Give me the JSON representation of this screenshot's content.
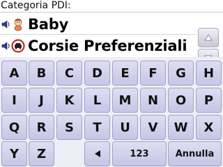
{
  "header": {
    "title": "Categoria PDI:"
  },
  "results": [
    {
      "label": "Baby",
      "speaker_icon": "speaker-icon",
      "category_icon": "baby-icon"
    },
    {
      "label": "Corsie Preferenziali",
      "speaker_icon": "speaker-icon",
      "category_icon": "car-pool-lane-icon"
    }
  ],
  "scroll": {
    "up_icon": "triangle-up-icon",
    "down_icon": "triangle-down-icon"
  },
  "keyboard": {
    "rows": [
      [
        "A",
        "B",
        "C",
        "D",
        "E",
        "F",
        "G",
        "H"
      ],
      [
        "I",
        "J",
        "K",
        "L",
        "M",
        "N",
        "O",
        "P"
      ],
      [
        "Q",
        "R",
        "S",
        "T",
        "U",
        "V",
        "W",
        "X"
      ],
      [
        "Y",
        "Z"
      ]
    ],
    "backspace_icon": "backspace-left-arrow-icon",
    "numbers_label": "123",
    "cancel_label": "Annulla"
  },
  "colors": {
    "key_fill_top": "#dedef2",
    "key_fill_bottom": "#c6c6e6",
    "key_border": "#a0a0c8",
    "keyboard_bg": "#eeeef6"
  }
}
